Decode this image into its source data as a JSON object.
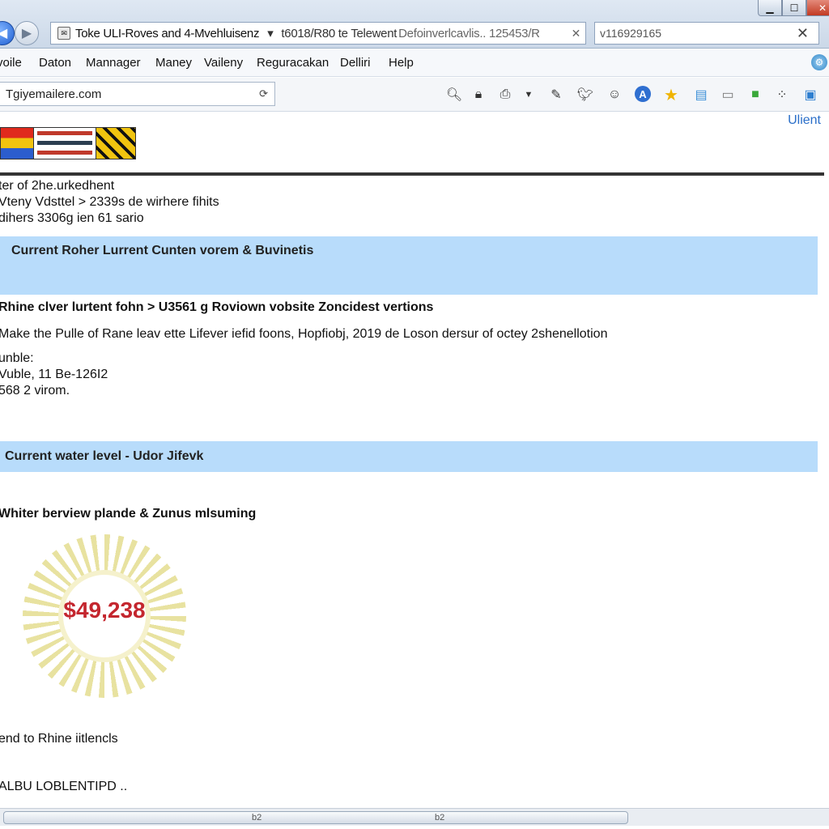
{
  "titlebar": {
    "tab_title_main": "Toke ULI-Roves and 4-Mvehluisenz",
    "tab_title_arrow": "▾",
    "tab_title_mid": "t6018/R80 te Telewent",
    "tab_title_muted": "Defoinverlcavlis.. 125453/R",
    "search_value": "v116929165"
  },
  "menu": {
    "items": [
      "voile",
      "Daton",
      "Mannager",
      "Maney",
      "Vaileny",
      "Reguracakan",
      "Delliri",
      "Help"
    ]
  },
  "toolbar": {
    "address_value": "Tgiyemailere.com"
  },
  "page": {
    "top_right_link": "Ulient",
    "intro_lines": [
      "ter of 2he.urkedhent",
      "Vteny Vdsttel > 2339s de wirhere fihits",
      "dihers 3306g ien 61 sario"
    ],
    "section1_heading": "Current Roher Lurrent Cunten vorem & Buvinetis",
    "section1_bold": "Rhine clver lurtent fohn > U3561 g Roviown vobsite Zoncidest vertions",
    "section1_text": "Make the Pulle of Rane leav ette Lifever iefid foons, Hopfiobj, 2019 de Loson dersur of octey 2shenellotion",
    "section1_lines": [
      "unble:",
      "Vuble, 11 Be-126I2",
      "568 2 virom."
    ],
    "section2_heading": "Current water level - Udor Jifevk",
    "section2_bold": "Whiter berview plande & Zunus mlsuming",
    "seal_amount": "$49,238",
    "footer_line1": "end to Rhine iitlencls",
    "footer_line2": "ALBU LOBLENTIPD .."
  },
  "scrollbar": {
    "marker_left": "b2",
    "marker_right": "b2"
  }
}
